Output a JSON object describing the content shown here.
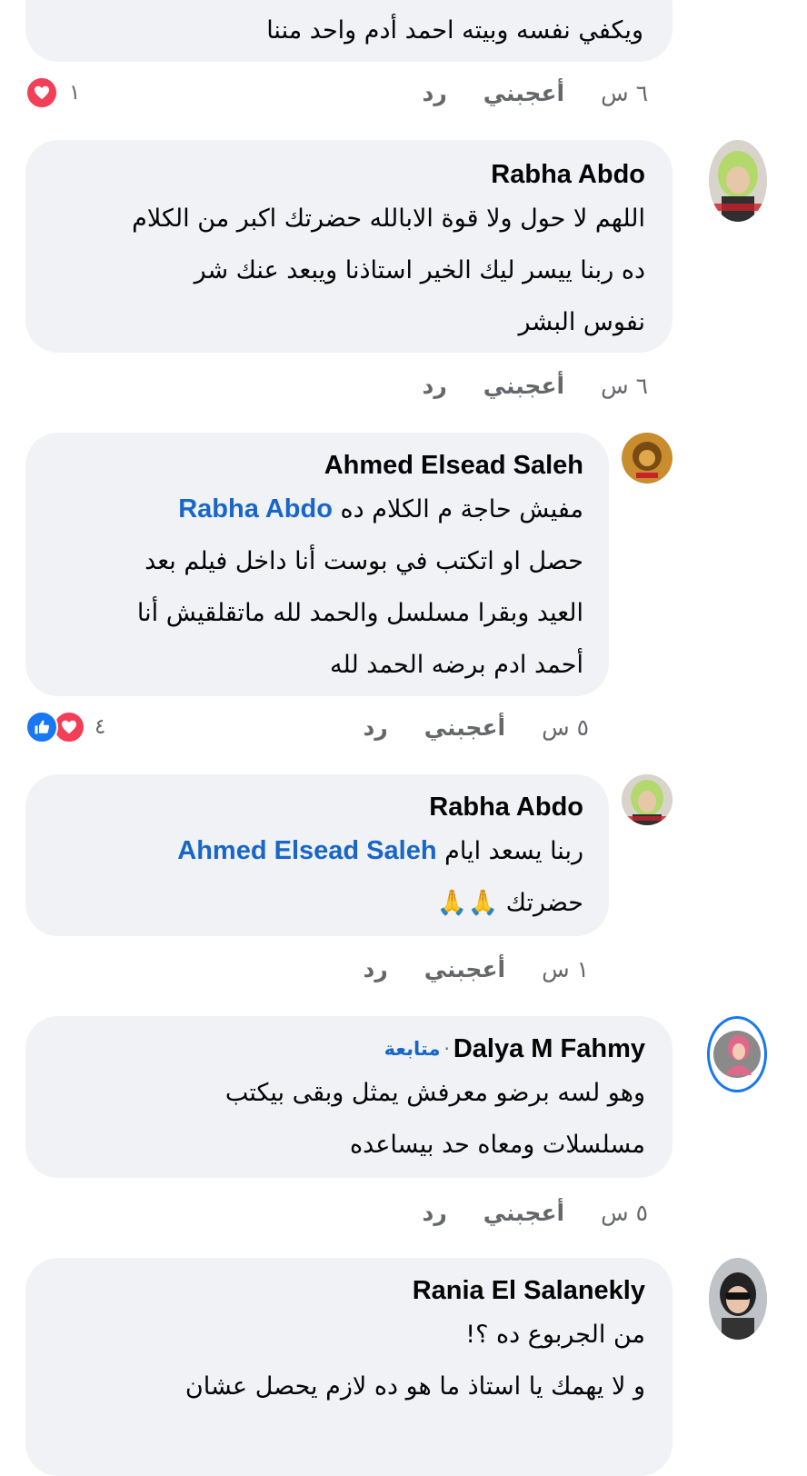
{
  "comments": [
    {
      "text_lines": [
        "ويكفي نفسه وبيته احمد أدم واحد مننا"
      ],
      "time": "٦ س",
      "like": "أعجبني",
      "reply": "رد",
      "reactions": {
        "count": "١",
        "types": [
          "love"
        ]
      }
    },
    {
      "author": "Rabha Abdo",
      "text_lines": [
        "اللهم لا حول ولا قوة الابالله حضرتك اكبر من الكلام",
        "ده ربنا ييسر ليك الخير استاذنا ويبعد عنك شر",
        "نفوس البشر"
      ],
      "time": "٦ س",
      "like": "أعجبني",
      "reply": "رد"
    },
    {
      "author": "Ahmed Elsead Saleh",
      "mention": "Rabha Abdo",
      "text_first": "مفيش حاجة م الكلام ده",
      "text_lines": [
        "حصل او اتكتب في بوست أنا داخل فيلم بعد",
        "العيد وبقرا مسلسل والحمد لله ماتقلقيش أنا",
        "أحمد ادم برضه الحمد لله"
      ],
      "time": "٥ س",
      "like": "أعجبني",
      "reply": "رد",
      "reactions": {
        "count": "٤",
        "types": [
          "love",
          "like"
        ]
      }
    },
    {
      "author": "Rabha Abdo",
      "mention": "Ahmed Elsead Saleh",
      "text_first": "ربنا يسعد ايام",
      "text_lines": [
        "حضرتك 🙏🙏"
      ],
      "time": "١ س",
      "like": "أعجبني",
      "reply": "رد"
    },
    {
      "author": "Dalya M Fahmy",
      "follow": "متابعة",
      "text_lines": [
        "وهو لسه برضو معرفش يمثل وبقى بيكتب",
        "مسلسلات ومعاه حد بيساعده"
      ],
      "time": "٥ س",
      "like": "أعجبني",
      "reply": "رد"
    },
    {
      "author": "Rania El Salanekly",
      "text_lines": [
        "من الجربوع ده ؟!",
        "و لا يهمك يا استاذ ما هو ده لازم يحصل عشان"
      ]
    }
  ],
  "colors": {
    "bubble": "#f0f2f5",
    "link": "#1866c8",
    "meta": "#65676b",
    "love": "#f33e58",
    "like": "#1877f2"
  },
  "icons": {
    "love": "heart-icon",
    "like": "thumbs-up-icon"
  }
}
